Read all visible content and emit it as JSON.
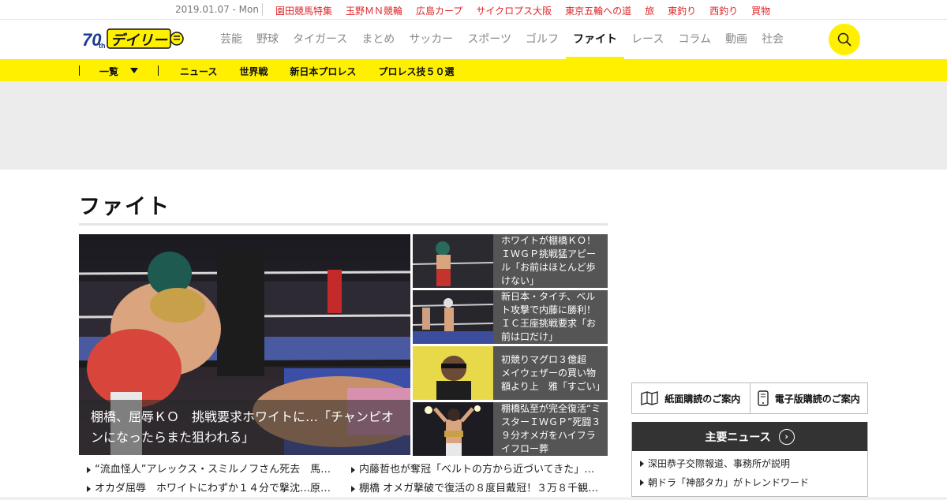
{
  "topbar": {
    "date": "2019.01.07 - Mon",
    "links": [
      "園田競馬特集",
      "玉野ＭＮ競輪",
      "広島カープ",
      "サイクロプス大阪",
      "東京五輪への道",
      "旅",
      "東釣り",
      "西釣り",
      "買物"
    ]
  },
  "header": {
    "logo_text": "デイリー",
    "logo_badge": "70th",
    "nav": [
      "芸能",
      "野球",
      "タイガース",
      "まとめ",
      "サッカー",
      "スポーツ",
      "ゴルフ",
      "ファイト",
      "レース",
      "コラム",
      "動画",
      "社会"
    ],
    "active_nav": "ファイト",
    "accent_color": "#fff000"
  },
  "subnav": {
    "ichiran": "一覧",
    "links": [
      "ニュース",
      "世界戦",
      "新日本プロレス",
      "プロレス技５０選"
    ]
  },
  "page": {
    "title": "ファイト"
  },
  "featured": {
    "caption": "棚橋、屈辱ＫＯ　挑戦要求ホワイトに…「チャンピオンになったらまた狙われる」"
  },
  "side_news": [
    {
      "text": "ホワイトが棚橋ＫＯ！ＩＷＧＰ挑戦猛アピール「お前はほとんど歩けない」"
    },
    {
      "text": "新日本・タイチ、ベルト攻撃で内藤に勝利！ＩＣ王座挑戦要求「お前は口だけ」"
    },
    {
      "text": "初競りマグロ３億超　メイウェザーの買い物額より上　雅「すごい」"
    },
    {
      "text": "棚橋弘至が完全復活“ミスターＩＷＧＰ”死闘３９分オメガをハイフライフロー葬"
    }
  ],
  "headlines_left": [
    "“流血怪人”アレックス・スミルノフさん死去　馬…",
    "オカダ屈辱　ホワイトにわずか１４分で撃沈…原…"
  ],
  "headlines_right": [
    "内藤哲也が奪冠「ベルトの方から近づいてきた」…",
    "棚橋 オメガ撃破で復活の８度目戴冠！３万８千観…"
  ],
  "subscribe": {
    "paper": "紙面購読のご案内",
    "digital": "電子版購読のご案内"
  },
  "major_news": {
    "title": "主要ニュース",
    "items": [
      "深田恭子交際報道、事務所が説明",
      "朝ドラ「神部タカ」がトレンドワード"
    ]
  }
}
